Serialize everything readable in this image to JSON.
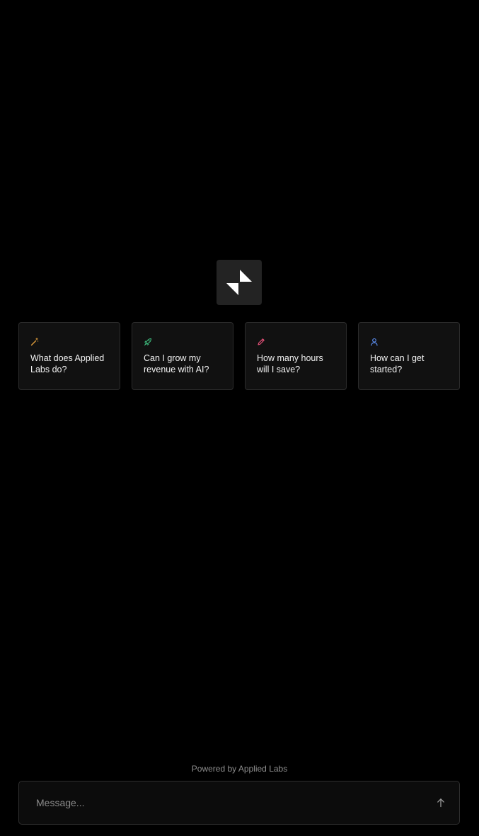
{
  "suggestions": [
    {
      "icon": "magic-wand-icon",
      "color": "#e8a33d",
      "label": "What does Applied Labs do?"
    },
    {
      "icon": "rocket-icon",
      "color": "#3fbf7f",
      "label": "Can I grow my revenue with AI?"
    },
    {
      "icon": "pencil-icon",
      "color": "#e8527a",
      "label": "How many hours will I save?"
    },
    {
      "icon": "user-icon",
      "color": "#5b8def",
      "label": "How can I get started?"
    }
  ],
  "footer": {
    "powered_by": "Powered by Applied Labs"
  },
  "composer": {
    "placeholder": "Message...",
    "send_icon": "arrow-up-icon"
  },
  "colors": {
    "background": "#000000",
    "card_background": "#111111",
    "card_border": "#2c2c2c",
    "logo_tile": "#232323"
  }
}
